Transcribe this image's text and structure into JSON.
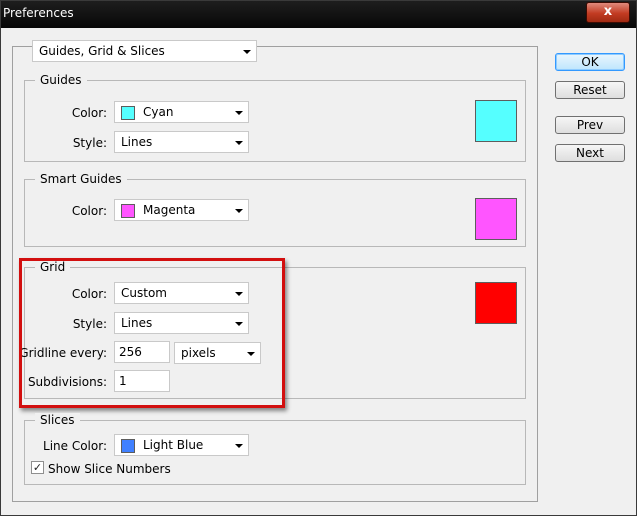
{
  "window": {
    "title": "Preferences",
    "close_label": "x"
  },
  "category": {
    "selected": "Guides, Grid & Slices"
  },
  "buttons": {
    "ok": "OK",
    "reset": "Reset",
    "prev": "Prev",
    "next": "Next"
  },
  "guides": {
    "legend": "Guides",
    "color_label": "Color:",
    "color_value": "Cyan",
    "color_hex": "#55ffff",
    "style_label": "Style:",
    "style_value": "Lines"
  },
  "smart_guides": {
    "legend": "Smart Guides",
    "color_label": "Color:",
    "color_value": "Magenta",
    "color_hex": "#ff55ff"
  },
  "grid": {
    "legend": "Grid",
    "color_label": "Color:",
    "color_value": "Custom",
    "color_hex": "#ff0000",
    "style_label": "Style:",
    "style_value": "Lines",
    "gridline_label": "Gridline every:",
    "gridline_value": "256",
    "gridline_unit": "pixels",
    "subdivisions_label": "Subdivisions:",
    "subdivisions_value": "1"
  },
  "slices": {
    "legend": "Slices",
    "line_color_label": "Line Color:",
    "line_color_value": "Light Blue",
    "line_color_hex": "#4080ff",
    "show_numbers_label": "Show Slice Numbers",
    "show_numbers_checked": true
  },
  "icons": {
    "checkbox": "check-icon",
    "dropdown": "chevron-down-icon"
  },
  "colors": {
    "highlight": "#d20f0f"
  }
}
